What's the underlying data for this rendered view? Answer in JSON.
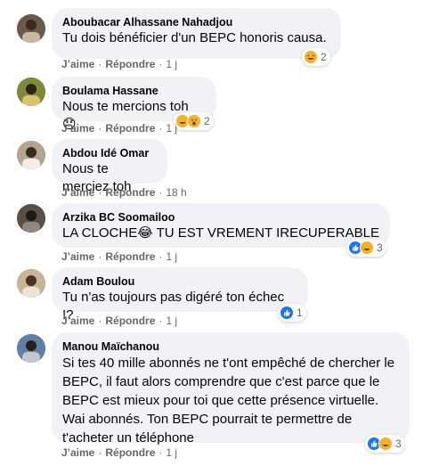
{
  "actions": {
    "like": "J’aime",
    "reply": "Répondre",
    "separator": "·"
  },
  "comments": [
    {
      "author": "Aboubacar Alhassane Nahadjou",
      "text": "Tu dois bénéficier d'un BEPC honoris causa.",
      "time": "1 j",
      "reactions": {
        "icons": [
          "haha-icon"
        ],
        "count": "2"
      }
    },
    {
      "author": "Boulama Hassane",
      "text": "Nous te mercions toh 😞",
      "time": "1 j",
      "reactions": {
        "icons": [
          "haha-icon",
          "wow-icon"
        ],
        "count": "2"
      }
    },
    {
      "author": "Abdou Idé Omar",
      "text": "Nous te merciez toh",
      "time": "18 h",
      "reactions": null
    },
    {
      "author": "Arzika BC Soomailoo",
      "text": "LA CLOCHE😂 TU EST VREMENT IRECUPERABLE",
      "time": "1 j",
      "reactions": {
        "icons": [
          "like-icon",
          "haha-icon"
        ],
        "count": "3"
      }
    },
    {
      "author": "Adam Boulou",
      "text": "Tu n'as toujours pas digéré ton échec !?",
      "time": "1 j",
      "reactions": {
        "icons": [
          "like-icon"
        ],
        "count": "1"
      }
    },
    {
      "author": "Manou Maïchanou",
      "text": "Si tes 40 mille abonnés ne t'ont empêché de chercher le BEPC, il faut alors comprendre que c'est parce que le BEPC est mieux pour toi que cette présence virtuelle. Wai abonnés. Ton BEPC pourrait te permettre de t'acheter un téléphone",
      "time": "1 j",
      "reactions": {
        "icons": [
          "like-icon",
          "haha-icon"
        ],
        "count": "3"
      }
    }
  ],
  "colors": {
    "bubble": "#f0f2f5",
    "like_blue": "#1877f2",
    "haha_yellow": "#f7b125",
    "meta_gray": "#65676b"
  }
}
